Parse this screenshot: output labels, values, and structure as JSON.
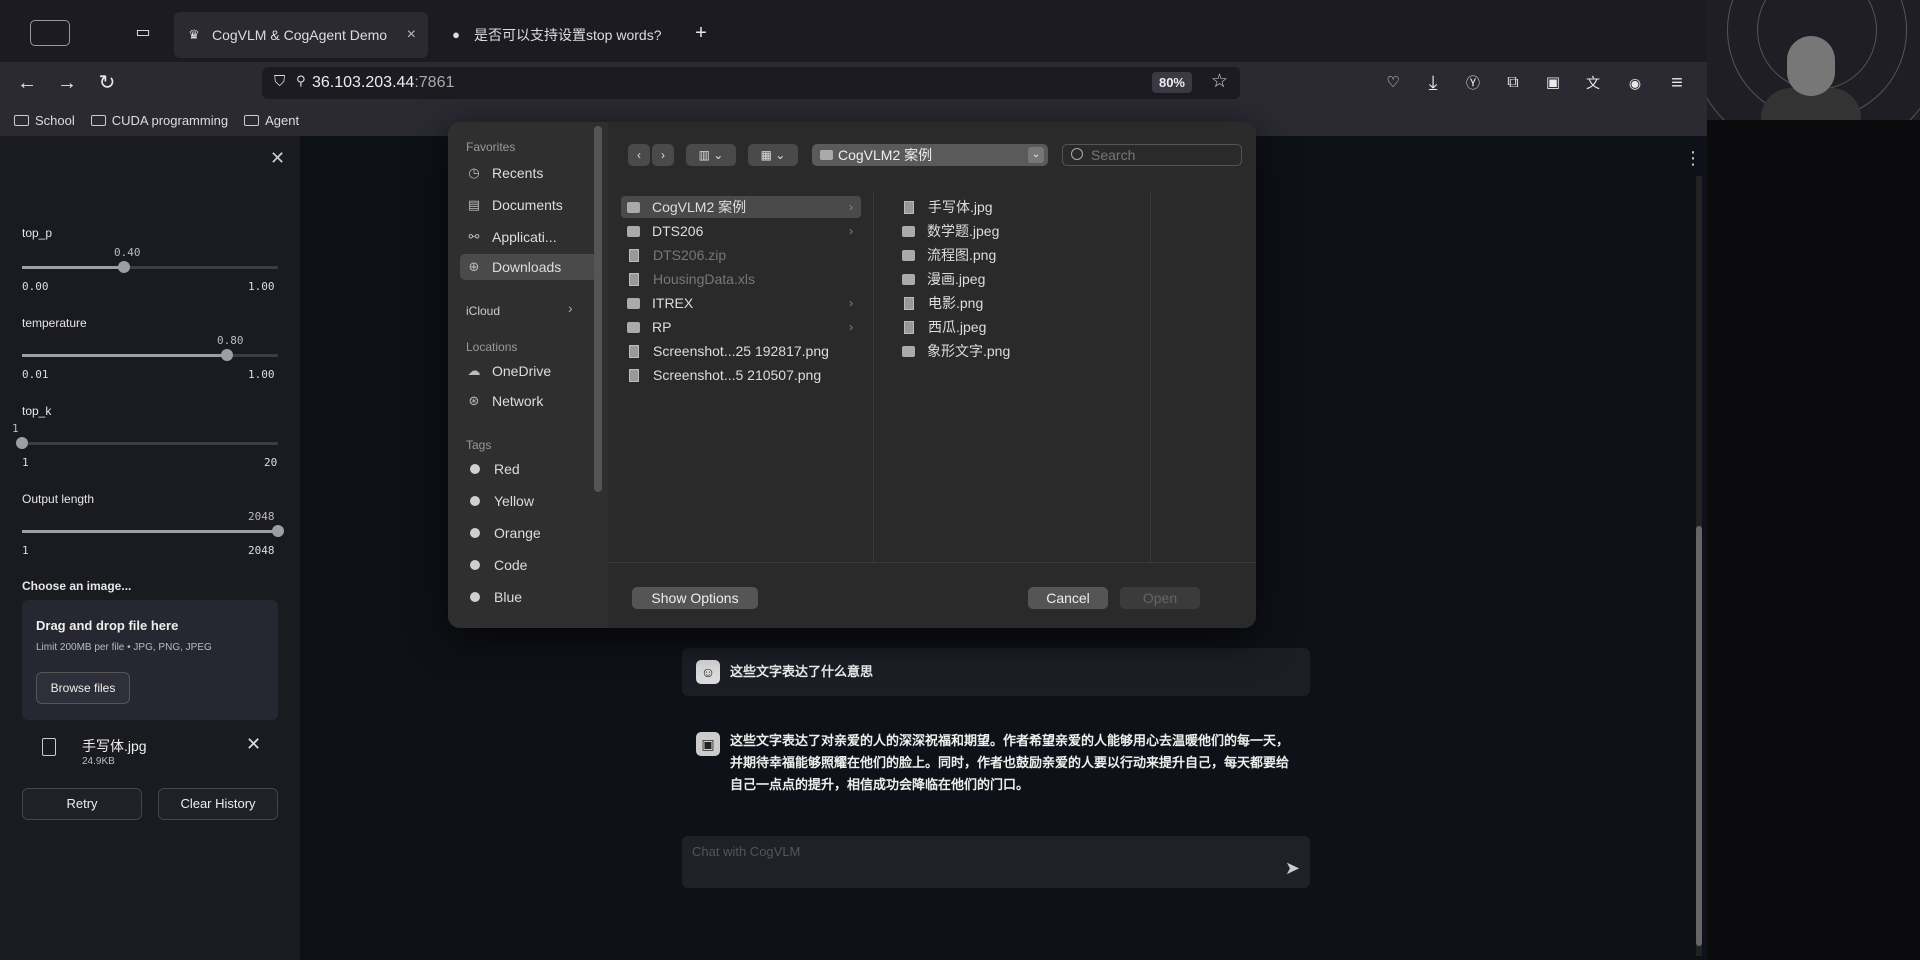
{
  "browser": {
    "tabs": [
      {
        "title": "CogVLM & CogAgent Demo",
        "active": true
      },
      {
        "title": "是否可以支持设置stop words?",
        "active": false
      }
    ],
    "url_host": "36.103.203.44",
    "url_port": ":7861",
    "zoom": "80%",
    "bookmarks": [
      "School",
      "CUDA programming",
      "Agent"
    ]
  },
  "sidebar": {
    "sliders": [
      {
        "label": "top_p",
        "value": "0.40",
        "min": "0.00",
        "max": "1.00",
        "fraction": 0.4
      },
      {
        "label": "temperature",
        "value": "0.80",
        "min": "0.01",
        "max": "1.00",
        "fraction": 0.8
      },
      {
        "label": "top_k",
        "value": "1",
        "min": "1",
        "max": "20",
        "fraction": 0.0
      },
      {
        "label": "Output length",
        "value": "2048",
        "min": "1",
        "max": "2048",
        "fraction": 1.0
      }
    ],
    "uploader_label": "Choose an image...",
    "drop_title": "Drag and drop file here",
    "drop_hint": "Limit 200MB per file • JPG, PNG, JPEG",
    "browse_label": "Browse files",
    "file_name": "手写体.jpg",
    "file_size": "24.9KB",
    "retry_label": "Retry",
    "clear_label": "Clear History"
  },
  "chat": {
    "user_message": "这些文字表达了什么意思",
    "bot_message": "这些文字表达了对亲爱的人的深深祝福和期望。作者希望亲爱的人能够用心去温暖他们的每一天，并期待幸福能够照耀在他们的脸上。同时，作者也鼓励亲爱的人要以行动来提升自己，每天都要给自己一点点的提升，相信成功会降临在他们的门口。",
    "input_placeholder": "Chat with CogVLM"
  },
  "dialog": {
    "sidebar": {
      "favorites_header": "Favorites",
      "favorites": [
        "Recents",
        "Documents",
        "Applicati...",
        "Downloads"
      ],
      "selected": "Downloads",
      "icloud_header": "iCloud",
      "locations_header": "Locations",
      "locations": [
        "OneDrive",
        "Network"
      ],
      "tags_header": "Tags",
      "tags": [
        {
          "name": "Red",
          "color": "#d0d0d0"
        },
        {
          "name": "Yellow",
          "color": "#d0d0d0"
        },
        {
          "name": "Orange",
          "color": "#d0d0d0"
        },
        {
          "name": "Code",
          "color": "#d0d0d0"
        },
        {
          "name": "Blue",
          "color": "#d0d0d0"
        }
      ]
    },
    "path_label": "CogVLM2 案例",
    "search_placeholder": "Search",
    "column1": [
      {
        "name": "CogVLM2 案例",
        "kind": "folder",
        "selected": true,
        "arrow": true
      },
      {
        "name": "DTS206",
        "kind": "folder",
        "arrow": true
      },
      {
        "name": "DTS206.zip",
        "kind": "file",
        "dim": true
      },
      {
        "name": "HousingData.xls",
        "kind": "file",
        "dim": true
      },
      {
        "name": "ITREX",
        "kind": "folder",
        "arrow": true
      },
      {
        "name": "RP",
        "kind": "folder",
        "arrow": true
      },
      {
        "name": "Screenshot...25 192817.png",
        "kind": "file"
      },
      {
        "name": "Screenshot...5 210507.png",
        "kind": "file"
      }
    ],
    "column2": [
      "手写体.jpg",
      "数学题.jpeg",
      "流程图.png",
      "漫画.jpeg",
      "电影.png",
      "西瓜.jpeg",
      "象形文字.png"
    ],
    "show_options": "Show Options",
    "cancel": "Cancel",
    "open": "Open"
  }
}
